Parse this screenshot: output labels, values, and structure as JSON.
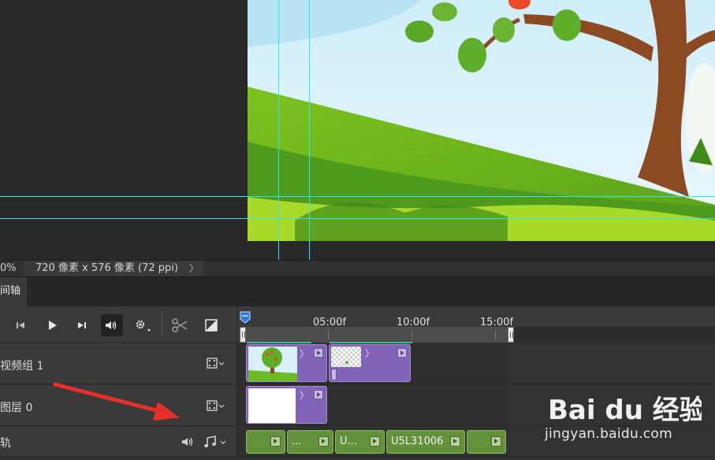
{
  "status_bar": {
    "zoom": "0%",
    "doc_info": "720 像素 x 576 像素 (72 ppi)",
    "more_arrow": "〉"
  },
  "panel": {
    "tab_label": "间轴"
  },
  "controls": {
    "icons": [
      "go-to-first-frame-icon",
      "play-icon",
      "go-to-next-frame-icon",
      "audio-icon",
      "settings-icon",
      "split-scissors-icon",
      "transition-icon"
    ]
  },
  "ruler": {
    "ticks": [
      "05:00f",
      "10:00f",
      "15:00f"
    ]
  },
  "tracks": [
    {
      "name": "视频组 1",
      "clips": [
        {
          "arrow": "〉"
        },
        {
          "arrow": "〉"
        }
      ]
    },
    {
      "name": "图层 0",
      "clips": [
        {
          "arrow": "〉"
        }
      ]
    },
    {
      "name": "轨",
      "audio_clips": [
        "",
        "...",
        "U...",
        "U5L31006",
        ""
      ]
    }
  ],
  "watermark": {
    "brand": "Bai du 经验",
    "url": "jingyan.baidu.com"
  },
  "colors": {
    "guide": "#2ee6f0",
    "video_clip": "#8163b7",
    "audio_clip": "#64913b",
    "annotation_arrow": "#e5312c"
  }
}
